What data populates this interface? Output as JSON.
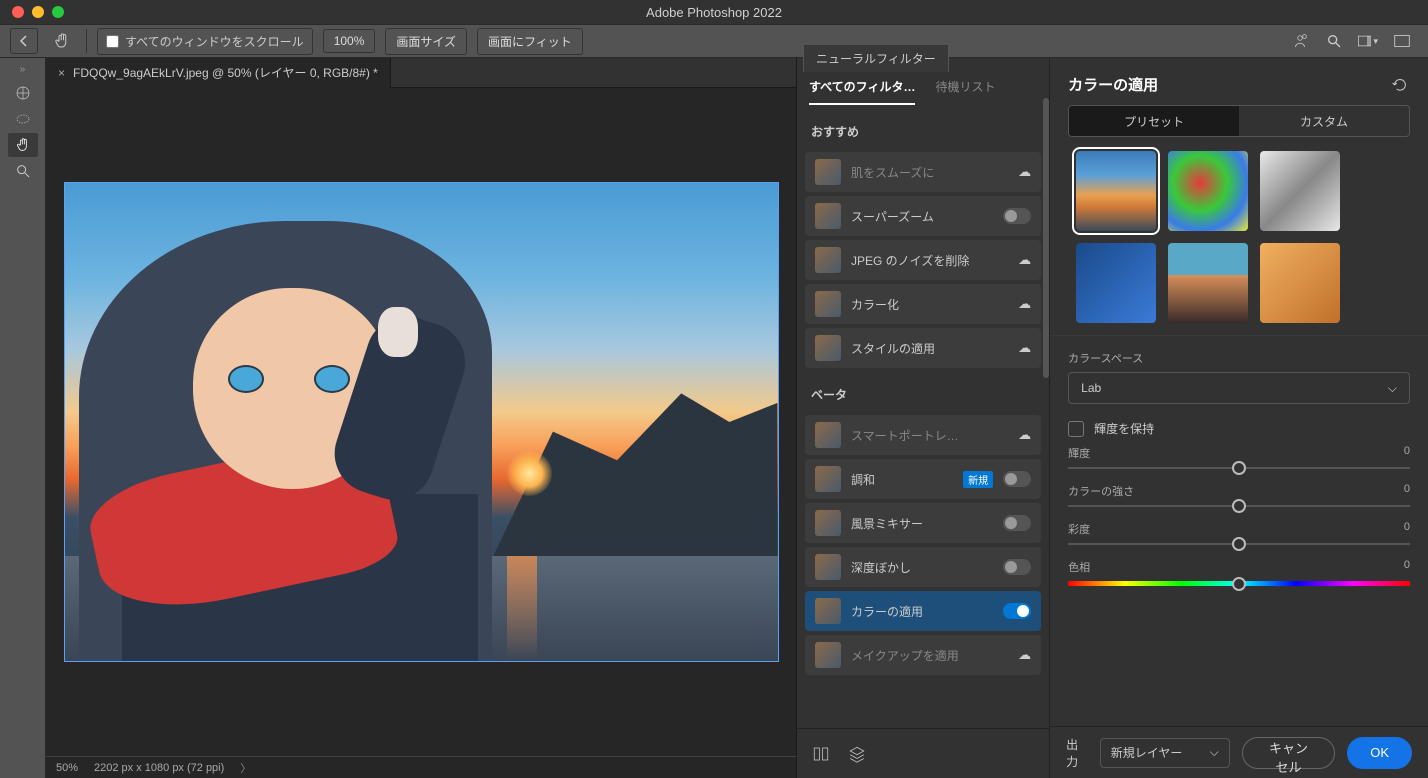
{
  "app_title": "Adobe Photoshop 2022",
  "options": {
    "scroll_all": "すべてのウィンドウをスクロール",
    "zoom100": "100%",
    "fit_image": "画面サイズ",
    "fit_screen": "画面にフィット"
  },
  "doc": {
    "tab": "FDQQw_9agAEkLrV.jpeg @ 50% (レイヤー 0, RGB/8#) *",
    "status_zoom": "50%",
    "status_dims": "2202 px x 1080 px (72 ppi)"
  },
  "nf_tab": "ニューラルフィルター",
  "filter_tabs": {
    "all": "すべてのフィルタ…",
    "wait": "待機リスト"
  },
  "sections": {
    "recommended": "おすすめ",
    "beta": "ベータ"
  },
  "filters": {
    "skin": "肌をスムーズに",
    "superzoom": "スーパーズーム",
    "jpeg": "JPEG のノイズを削除",
    "colorize": "カラー化",
    "style": "スタイルの適用",
    "smartportrait": "スマートポートレ…",
    "harmonize": "調和",
    "landscape": "風景ミキサー",
    "depthblur": "深度ぼかし",
    "colortransfer": "カラーの適用",
    "makeup": "メイクアップを適用"
  },
  "badge_new": "新規",
  "settings": {
    "title": "カラーの適用",
    "preset_tab": "プリセット",
    "custom_tab": "カスタム",
    "colorspace_label": "カラースペース",
    "colorspace_value": "Lab",
    "preserve_lum": "輝度を保持",
    "sliders": {
      "luminance": {
        "label": "輝度",
        "value": "0"
      },
      "strength": {
        "label": "カラーの強さ",
        "value": "0"
      },
      "saturation": {
        "label": "彩度",
        "value": "0"
      },
      "hue": {
        "label": "色相",
        "value": "0"
      }
    }
  },
  "footer": {
    "output_label": "出力",
    "output_value": "新規レイヤー",
    "cancel": "キャンセル",
    "ok": "OK"
  }
}
